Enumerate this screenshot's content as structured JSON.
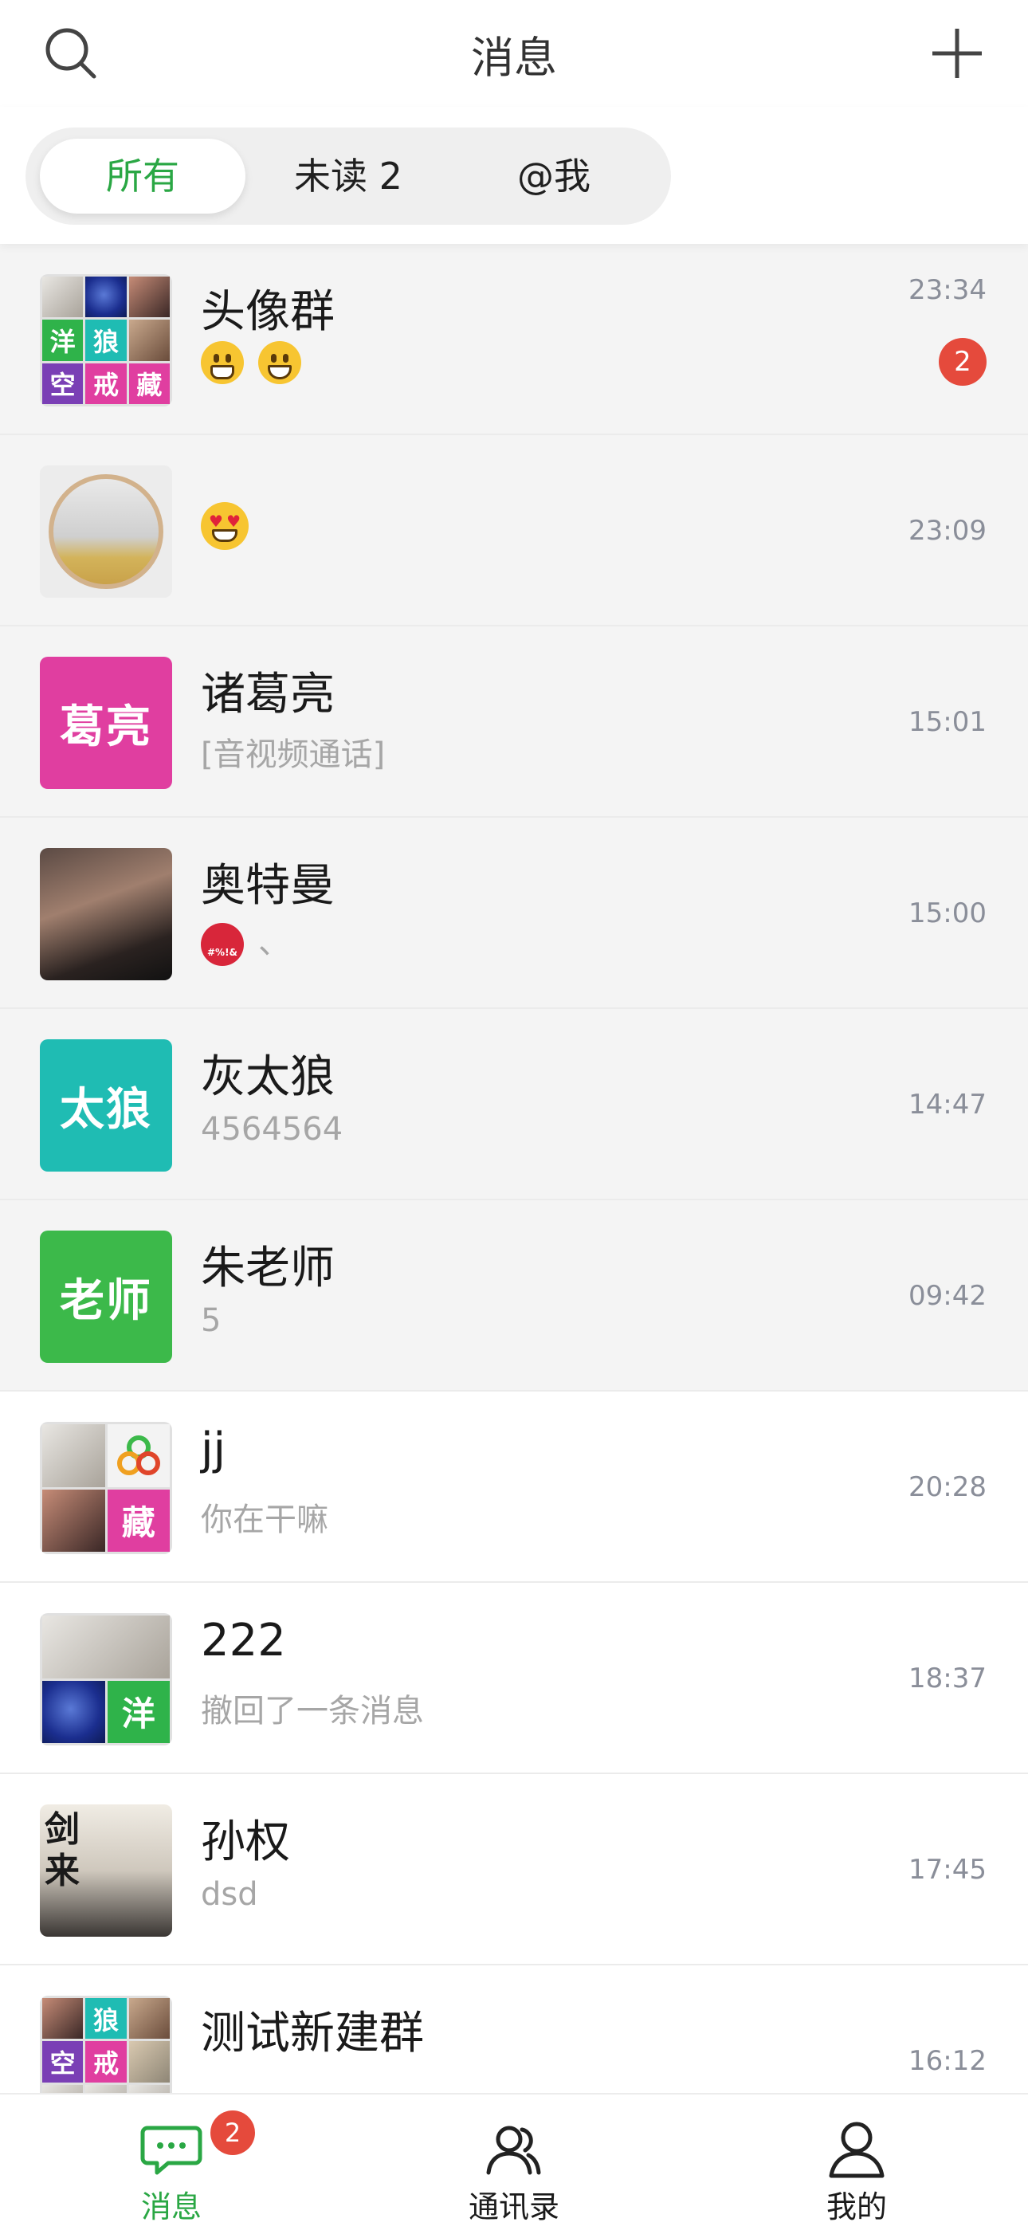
{
  "header": {
    "title": "消息",
    "search_icon": "search-icon",
    "add_icon": "plus-icon"
  },
  "filters": [
    {
      "label": "所有",
      "active": true
    },
    {
      "label": "未读 2",
      "active": false
    },
    {
      "label": "@我",
      "active": false
    }
  ],
  "conversations": [
    {
      "name": "头像群",
      "preview": "",
      "preview_emojis": [
        "grimacing-emoji",
        "grin-emoji"
      ],
      "time": "23:34",
      "unread": "2",
      "avatar_cells": [
        "",
        "",
        "",
        "洋",
        "狼",
        "",
        "空",
        "戒",
        "藏"
      ]
    },
    {
      "name": "",
      "preview": "",
      "preview_emojis": [
        "heart-eyes-emoji"
      ],
      "time": "23:09"
    },
    {
      "name": "诸葛亮",
      "preview": "[音视频通话]",
      "time": "15:01",
      "avatar_text": "葛亮",
      "avatar_color": "#e03ea0"
    },
    {
      "name": "奥特曼",
      "preview": "、",
      "preview_emojis": [
        "cursing-emoji"
      ],
      "time": "15:00"
    },
    {
      "name": "灰太狼",
      "preview": "4564564",
      "time": "14:47",
      "avatar_text": "太狼",
      "avatar_color": "#1fbcb3"
    },
    {
      "name": "朱老师",
      "preview": "5",
      "time": "09:42",
      "avatar_text": "老师",
      "avatar_color": "#3cb94a"
    },
    {
      "name": "jj",
      "preview": "你在干嘛",
      "time": "20:28",
      "avatar_cells": [
        "",
        "",
        "",
        "藏"
      ]
    },
    {
      "name": "222",
      "preview": "撤回了一条消息",
      "time": "18:37",
      "avatar_cells": [
        "",
        "",
        "",
        "洋"
      ]
    },
    {
      "name": "孙权",
      "preview": "dsd",
      "time": "17:45",
      "avatar_poster": "剑来"
    },
    {
      "name": "测试新建群",
      "preview": "",
      "time": "16:12",
      "avatar_cells": [
        "",
        "狼",
        "",
        "空",
        "戒",
        "",
        "",
        "",
        ""
      ]
    }
  ],
  "cell_colors": {
    "洋": "#2fb34a",
    "狼": "#1fbcb3",
    "空": "#7a3fb5",
    "戒": "#e03ea0",
    "藏": "#e03ea0"
  },
  "tabbar": [
    {
      "label": "消息",
      "icon": "chat-icon",
      "active": true,
      "badge": "2"
    },
    {
      "label": "通讯录",
      "icon": "contacts-icon",
      "active": false
    },
    {
      "label": "我的",
      "icon": "profile-icon",
      "active": false
    }
  ],
  "colors": {
    "accent": "#2aa744",
    "badge": "#e54a3c"
  }
}
